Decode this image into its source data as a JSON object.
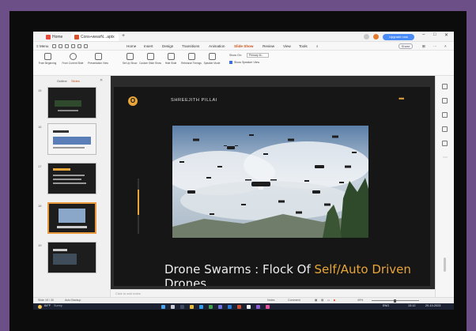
{
  "window": {
    "tab_home": "Home",
    "tab_file": "Cons+wearN...aptx",
    "new_tab": "+",
    "upgrade_button": "Upgrade now"
  },
  "menu": {
    "items": [
      "≡ Menu",
      "Home",
      "Insert",
      "Design",
      "Transitions",
      "Animation",
      "Slide Show",
      "Review",
      "View",
      "Tools"
    ],
    "active": "Slide Show",
    "share": "Share"
  },
  "ribbon": {
    "buttons": [
      "From Beginning",
      "From Current Slide",
      "Presentation View",
      "Set Up Show",
      "Custom Slide Show",
      "Hide Slide",
      "Rehearse Timings",
      "Speaker Mode"
    ],
    "show_on_label": "Show On:",
    "show_on_value": "Primary M...",
    "use_speaker": "Show Speaker View"
  },
  "left_panel": {
    "tab_outline": "Outline",
    "tab_slides": "Slides",
    "slide_numbers": [
      "15",
      "16",
      "17",
      "18",
      "19"
    ],
    "add_slide": "+"
  },
  "slide": {
    "logo_letter": "O",
    "author": "SHREEJITH PILLAI",
    "more": "•••",
    "title_prefix": "Drone Swarms : Flock Of ",
    "title_highlight": "Self/Auto Driven",
    "title_line2": "Drones"
  },
  "notes": {
    "placeholder": "Click to add notes"
  },
  "statusbar": {
    "slide_count": "Slide 19 / 30",
    "autosave": "Auto Backup",
    "notes": "Notes",
    "comment": "Comment",
    "zoom": "49%"
  },
  "taskbar": {
    "weather_temp": "84°F",
    "weather_desc": "Sunny",
    "lang": "ENG",
    "time": "13:12",
    "date": "20-10-2023"
  },
  "colors": {
    "accent_orange": "#e8a53a",
    "slide_bg": "#161616",
    "active_menu": "#c9541b"
  }
}
